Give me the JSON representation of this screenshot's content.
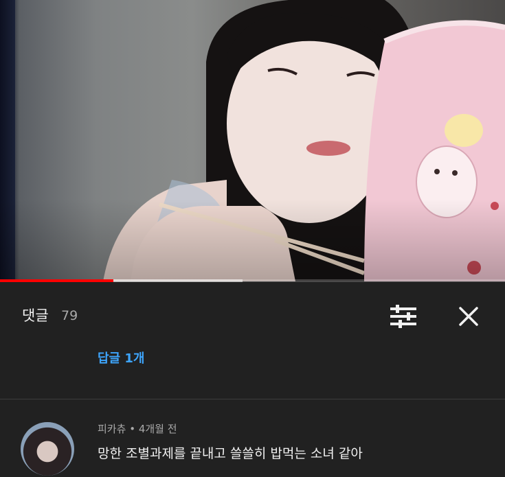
{
  "video": {
    "progress_played": 0.225,
    "progress_buffered": 0.48,
    "played_color": "#ff0000"
  },
  "comments_header": {
    "title": "댓글",
    "count": "79",
    "sort_icon": "tune-icon",
    "close_icon": "close-icon"
  },
  "replies": {
    "label": "답글 1개"
  },
  "comment": {
    "author": "피카츄",
    "separator": "•",
    "time": "4개월 전",
    "text": "망한 조별과제를 끝내고 쓸쓸히 밥먹는 소녀 같아"
  },
  "colors": {
    "background": "#212121",
    "primary_text": "#f1f1f1",
    "secondary_text": "#aaaaaa",
    "link": "#3ea6ff",
    "divider": "#3d3d3d"
  }
}
